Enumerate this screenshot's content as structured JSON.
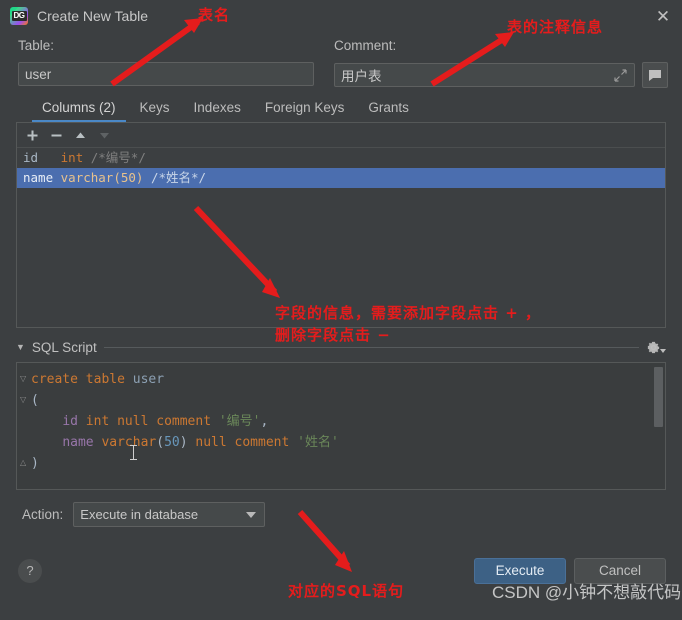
{
  "window": {
    "title": "Create New Table",
    "app_icon": "datagrip-icon",
    "icon_label": "DG",
    "close_icon": "close-icon"
  },
  "form": {
    "table_label": "Table:",
    "table_value": "user",
    "comment_label": "Comment:",
    "comment_value": "用户表",
    "expand_icon": "expand-icon",
    "comment_button_icon": "comment-bubble-icon"
  },
  "tabs": [
    {
      "label": "Columns (2)",
      "active": true
    },
    {
      "label": "Keys",
      "active": false
    },
    {
      "label": "Indexes",
      "active": false
    },
    {
      "label": "Foreign Keys",
      "active": false
    },
    {
      "label": "Grants",
      "active": false
    }
  ],
  "columns_toolbar": [
    {
      "icon": "plus-icon",
      "glyph": "+",
      "enabled": true
    },
    {
      "icon": "minus-icon",
      "glyph": "−",
      "enabled": true
    },
    {
      "icon": "move-up-icon",
      "glyph": "▲",
      "enabled": true
    },
    {
      "icon": "move-down-icon",
      "glyph": "▼",
      "enabled": false
    }
  ],
  "columns": [
    {
      "name": "id",
      "type": "int",
      "comment": "/*编号*/",
      "selected": false
    },
    {
      "name": "name",
      "type": "varchar(50)",
      "comment": "/*姓名*/",
      "selected": true
    }
  ],
  "sql_section": {
    "title": "SQL Script",
    "twisty_icon": "chevron-down-icon",
    "gear_icon": "gear-icon",
    "code_lines": [
      "create table user",
      "(",
      "    id int null comment '编号',",
      "    name varchar(50) null comment '姓名'",
      ")"
    ]
  },
  "action": {
    "label": "Action:",
    "selected": "Execute in database",
    "dropdown_icon": "chevron-down-icon"
  },
  "buttons": {
    "help": "?",
    "execute": "Execute",
    "cancel": "Cancel"
  },
  "annotations": {
    "table_name": "表名",
    "table_comment": "表的注释信息",
    "columns_info_line1": "字段的信息，需要添加字段点击 + ，",
    "columns_info_line2": "删除字段点击 −",
    "sql_statement": "对应的SQL语句"
  },
  "watermark": "CSDN @小钟不想敲代码",
  "colors": {
    "dialog_bg": "#3c3f41",
    "selection_blue": "#4b6eaf",
    "tab_underline": "#4a88c7",
    "annotation_red": "#e51c1c",
    "primary_button": "#3d6185",
    "keyword_orange": "#cc7832",
    "string_green": "#6a8759",
    "identifier_purple": "#9876aa"
  }
}
